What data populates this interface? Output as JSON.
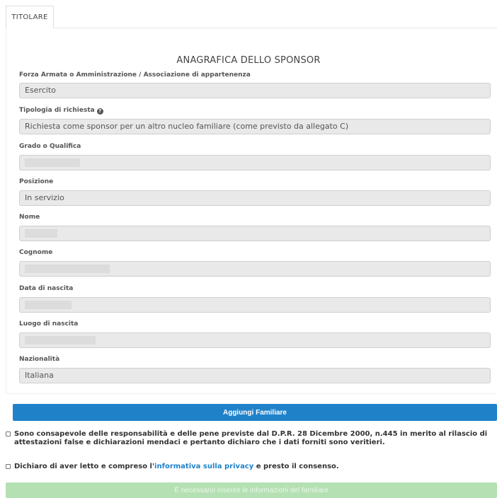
{
  "tabs": [
    {
      "label": "TITOLARE"
    }
  ],
  "section_title": "ANAGRAFICA DELLO SPONSOR",
  "fields": {
    "forza_armata": {
      "label": "Forza Armata o Amministrazione / Associazione di appartenenza",
      "value": "Esercito"
    },
    "tipologia": {
      "label": "Tipologia di richiesta",
      "value": "Richiesta come sponsor per un altro nucleo familiare (come previsto da allegato C)"
    },
    "grado": {
      "label": "Grado o Qualifica",
      "value": ""
    },
    "posizione": {
      "label": "Posizione",
      "value": "In servizio"
    },
    "nome": {
      "label": "Nome",
      "value": ""
    },
    "cognome": {
      "label": "Cognome",
      "value": ""
    },
    "data_nascita": {
      "label": "Data di nascita",
      "value": ""
    },
    "luogo_nascita": {
      "label": "Luogo di nascita",
      "value": ""
    },
    "nazionalita": {
      "label": "Nazionalità",
      "value": "Italiana"
    }
  },
  "add_button_label": "Aggiungi Familiare",
  "declarations": {
    "responsabilita": "Sono consapevole delle responsabilità e delle pene previste dal D.P.R. 28 Dicembre 2000, n.445 in merito al rilascio di attestazioni false e dichiarazioni mendaci e pertanto dichiaro che i dati forniti sono veritieri.",
    "privacy_prefix": "Dichiaro di aver letto e compreso l'",
    "privacy_link": "informativa sulla privacy",
    "privacy_suffix": " e presto il consenso."
  },
  "submit_label": "È necessario inserire le informazioni del familiare"
}
